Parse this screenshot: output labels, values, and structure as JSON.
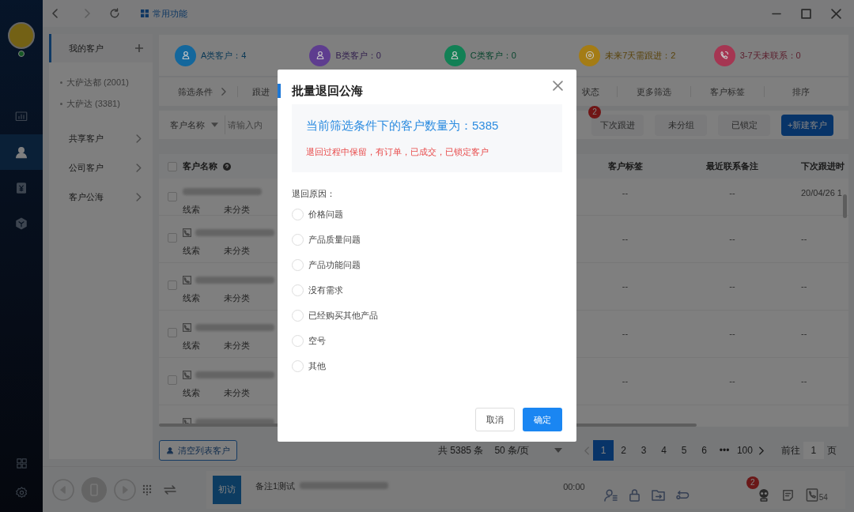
{
  "top_bar": {
    "shortcut": "常用功能"
  },
  "side_nav": {
    "items": [
      {
        "kind": "chart",
        "selected": false
      },
      {
        "kind": "user",
        "selected": true
      },
      {
        "kind": "yen",
        "selected": false
      },
      {
        "kind": "cube",
        "selected": false
      }
    ],
    "bottom": [
      {
        "kind": "grid"
      },
      {
        "kind": "gear"
      }
    ]
  },
  "customer_panel": {
    "items": [
      {
        "label": "我的客户",
        "kind": "header",
        "selected": true
      },
      {
        "label": "大萨达都 (2001)",
        "kind": "sub",
        "selected": false
      },
      {
        "label": "大萨达 (3381)",
        "kind": "sub",
        "selected": false
      },
      {
        "label": "共享客户",
        "kind": "link",
        "selected": false
      },
      {
        "label": "公司客户",
        "kind": "link",
        "selected": false
      },
      {
        "label": "客户公海",
        "kind": "link",
        "selected": false
      }
    ]
  },
  "stats": [
    {
      "label": "A类客户：4",
      "color": "#14679c",
      "kind": "user"
    },
    {
      "label": "B类客户：0",
      "color": "#5e3d8f",
      "kind": "user"
    },
    {
      "label": "C类客户：0",
      "color": "#128055",
      "kind": "user"
    },
    {
      "label": "未来7天需跟进：2",
      "color": "#a47c15",
      "kind": "target"
    },
    {
      "label": "3-7天未联系：0",
      "color": "#a53652",
      "kind": "phone"
    }
  ],
  "filters": {
    "left": [
      "筛选条件",
      "跟进"
    ],
    "right": [
      "状态",
      "更多筛选",
      "客户标签",
      "排序"
    ]
  },
  "search": {
    "field": "客户名称",
    "placeholder": "请输入内"
  },
  "actions": [
    {
      "label": "下次跟进",
      "kind": "plain",
      "badge": "2"
    },
    {
      "label": "未分组",
      "kind": "plain"
    },
    {
      "label": "已锁定",
      "kind": "plain"
    },
    {
      "label": "+新建客户",
      "kind": "primary"
    }
  ],
  "table": {
    "all_checked": false,
    "left_column": "客户名称",
    "right_columns": [
      "客户标签",
      "最近联系备注",
      "下次跟进时"
    ],
    "rows": [
      {
        "checked": false,
        "phone_icon": false,
        "type": "线索",
        "category": "未分类",
        "tag": "--",
        "note": "--",
        "next": "20/04/26 1"
      },
      {
        "checked": false,
        "phone_icon": true,
        "type": "线索",
        "category": "未分类",
        "tag": "--",
        "note": "--",
        "next": "--"
      },
      {
        "checked": false,
        "phone_icon": true,
        "type": "线索",
        "category": "未分类",
        "tag": "--",
        "note": "--",
        "next": "--"
      },
      {
        "checked": false,
        "phone_icon": true,
        "type": "线索",
        "category": "未分类",
        "tag": "--",
        "note": "--",
        "next": "--"
      },
      {
        "checked": false,
        "phone_icon": true,
        "type": "线索",
        "category": "未分类",
        "tag": "--",
        "note": "--",
        "next": "--"
      },
      {
        "phone_icon": true
      }
    ]
  },
  "clear_button": "清空列表客户",
  "pagination": {
    "total": "共 5385 条",
    "page_size": "50 条/页",
    "pages": [
      {
        "label": "1",
        "selected": true
      },
      {
        "label": "2",
        "selected": false
      },
      {
        "label": "3",
        "selected": false
      },
      {
        "label": "4",
        "selected": false
      },
      {
        "label": "5",
        "selected": false
      },
      {
        "label": "6",
        "selected": false
      },
      {
        "label": "•••",
        "selected": false
      },
      {
        "label": "100",
        "selected": false
      }
    ],
    "goto_label": "前往",
    "goto_value": "1",
    "page_unit": "页"
  },
  "call_bar": {
    "stage": "初访",
    "note": "备注1测试",
    "time": "00:00",
    "badge": "2",
    "count": "54"
  },
  "dialog": {
    "title": "批量退回公海",
    "count_text": "当前筛选条件下的客户数量为：5385",
    "warning": "退回过程中保留，有订单，已成交，已锁定客户",
    "reason_label": "退回原因：",
    "reasons": [
      {
        "label": "价格问题",
        "selected": false
      },
      {
        "label": "产品质量问题",
        "selected": false
      },
      {
        "label": "产品功能问题",
        "selected": false
      },
      {
        "label": "没有需求",
        "selected": false
      },
      {
        "label": "已经购买其他产品",
        "selected": false
      },
      {
        "label": "空号",
        "selected": false
      },
      {
        "label": "其他",
        "selected": false
      }
    ],
    "buttons": [
      {
        "label": "取消",
        "kind": "secondary"
      },
      {
        "label": "确定",
        "kind": "primary"
      }
    ]
  }
}
